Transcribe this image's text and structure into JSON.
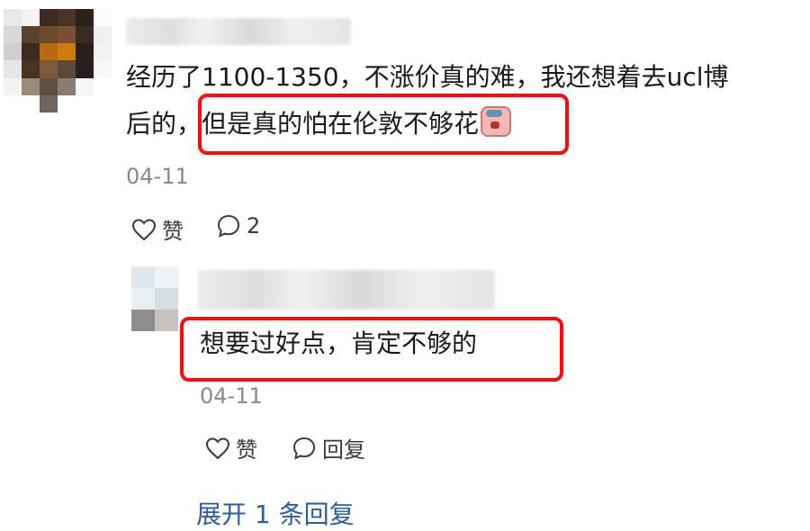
{
  "comment": {
    "line1": "经历了1100-1350，不涨价真的难，我还想着去ucl博",
    "line2_prefix": "后的，",
    "line2_highlight": "但是真的怕在伦敦不够花",
    "emoji": "crying-face-emoji",
    "date": "04-11",
    "like_label": "赞",
    "comment_count": "2"
  },
  "reply": {
    "text": "想要过好点，肯定不够的",
    "date": "04-11",
    "like_label": "赞",
    "reply_label": "回复"
  },
  "expand_replies": "展开 1 条回复",
  "colors": {
    "highlight": "#ff0a0a",
    "link": "#2b5ea8",
    "date": "#8a8a8a"
  },
  "avatars": {
    "main": [
      "#e9e9e9",
      "#f4f4f4",
      "#3b2b22",
      "#4a3423",
      "#2e2118",
      "#fafafa",
      "#d8d8d8",
      "#5a4030",
      "#6a4a2a",
      "#7a5030",
      "#3a2a1f",
      "#efefef",
      "#cfcfcf",
      "#3d2b1e",
      "#b86a10",
      "#d07a12",
      "#2a1e16",
      "#f2f2f2",
      "#e6e6e6",
      "#4a3222",
      "#7a5a3a",
      "#5a4a3a",
      "#282020",
      "#f7f7f7",
      "#f2f2f2",
      "#9a8a7a",
      "#5f4f45",
      "#8a7a70",
      "#f5f5f5",
      "#ffffff",
      "#ffffff",
      "#ffffff",
      "#6f6560",
      "#ffffff",
      "#ffffff",
      "#ffffff"
    ],
    "reply": [
      "#dfe7ec",
      "#eef2f4",
      "#e8eef1",
      "#d6dee2",
      "#8d8d8d",
      "#c9c1bd"
    ]
  }
}
